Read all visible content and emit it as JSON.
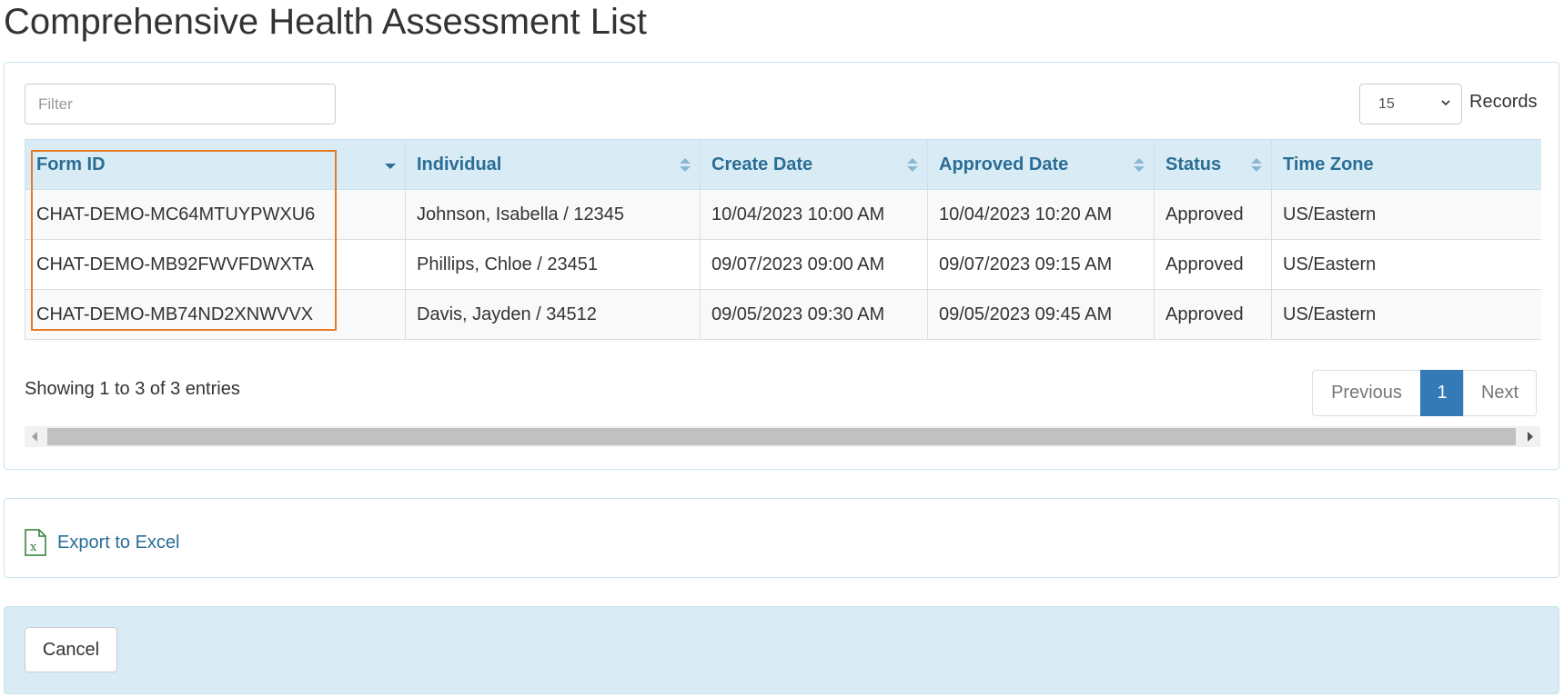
{
  "page": {
    "title": "Comprehensive Health Assessment List"
  },
  "toolbar": {
    "filter_placeholder": "Filter",
    "records_value": "15",
    "records_label": "Records"
  },
  "table": {
    "columns": [
      {
        "label": "Form ID",
        "sort": "desc"
      },
      {
        "label": "Individual",
        "sort": "both"
      },
      {
        "label": "Create Date",
        "sort": "both"
      },
      {
        "label": "Approved Date",
        "sort": "both"
      },
      {
        "label": "Status",
        "sort": "both"
      },
      {
        "label": "Time Zone",
        "sort": "none"
      }
    ],
    "rows": [
      [
        "CHAT-DEMO-MC64MTUYPWXU6",
        "Johnson, Isabella / 12345",
        "10/04/2023 10:00 AM",
        "10/04/2023 10:20 AM",
        "Approved",
        "US/Eastern"
      ],
      [
        "CHAT-DEMO-MB92FWVFDWXTA",
        "Phillips, Chloe / 23451",
        "09/07/2023 09:00 AM",
        "09/07/2023 09:15 AM",
        "Approved",
        "US/Eastern"
      ],
      [
        "CHAT-DEMO-MB74ND2XNWVVX",
        "Davis, Jayden / 34512",
        "09/05/2023 09:30 AM",
        "09/05/2023 09:45 AM",
        "Approved",
        "US/Eastern"
      ]
    ]
  },
  "footer": {
    "info": "Showing 1 to 3 of 3 entries",
    "prev_label": "Previous",
    "current_page": "1",
    "next_label": "Next"
  },
  "export": {
    "label": "Export to Excel",
    "icon": "excel-file-icon"
  },
  "actions": {
    "cancel_label": "Cancel"
  },
  "colors": {
    "header_bg": "#d9ecf5",
    "header_text": "#2a6d96",
    "accent": "#337ab7",
    "highlight": "#e57a28"
  }
}
